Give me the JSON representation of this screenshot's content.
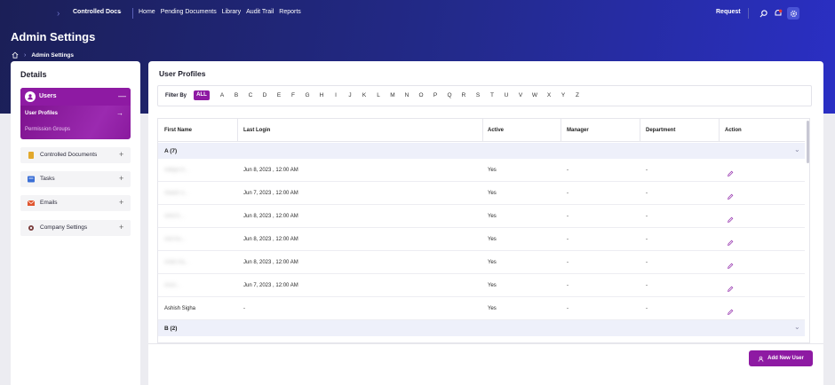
{
  "topbar": {
    "brand": "Controlled Docs",
    "nav": [
      "Home",
      "Pending Documents",
      "Library",
      "Audit Trail",
      "Reports"
    ],
    "request": "Request"
  },
  "header": {
    "title": "Admin Settings",
    "breadcrumb": "Admin Settings"
  },
  "sidebar": {
    "title": "Details",
    "users_label": "Users",
    "sub_items": [
      "User Profiles",
      "Permission Groups"
    ],
    "items": [
      {
        "label": "Controlled Documents",
        "icon": "document-icon",
        "color": "#e2a82c"
      },
      {
        "label": "Tasks",
        "icon": "tasks-icon",
        "color": "#3b6fd6"
      },
      {
        "label": "Emails",
        "icon": "mail-icon",
        "color": "#e0552f"
      },
      {
        "label": "Company Settings",
        "icon": "gear-icon",
        "color": "#7a3c3c"
      }
    ]
  },
  "main": {
    "title": "User Profiles",
    "filter_label": "Filter By",
    "filter_all": "ALL",
    "letters": [
      "A",
      "B",
      "C",
      "D",
      "E",
      "F",
      "G",
      "H",
      "I",
      "J",
      "K",
      "L",
      "M",
      "N",
      "O",
      "P",
      "Q",
      "R",
      "S",
      "T",
      "U",
      "V",
      "W",
      "X",
      "Y",
      "Z"
    ],
    "columns": [
      "First Name",
      "Last Login",
      "Active",
      "Manager",
      "Department",
      "Action"
    ],
    "groups": [
      {
        "label": "A (7)",
        "rows": [
          {
            "name": "Aditya R...",
            "last_login": "Jun 8, 2023 , 12:00 AM",
            "active": "Yes",
            "manager": "-",
            "department": "-"
          },
          {
            "name": "Akash S...",
            "last_login": "Jun 7, 2023 , 12:00 AM",
            "active": "Yes",
            "manager": "-",
            "department": "-"
          },
          {
            "name": "Amit K...",
            "last_login": "Jun 8, 2023 , 12:00 AM",
            "active": "Yes",
            "manager": "-",
            "department": "-"
          },
          {
            "name": "Anil Ku...",
            "last_login": "Jun 8, 2023 , 12:00 AM",
            "active": "Yes",
            "manager": "-",
            "department": "-"
          },
          {
            "name": "Ankit Ra...",
            "last_login": "Jun 8, 2023 , 12:00 AM",
            "active": "Yes",
            "manager": "-",
            "department": "-"
          },
          {
            "name": "Arun...",
            "last_login": "Jun 7, 2023 , 12:00 AM",
            "active": "Yes",
            "manager": "-",
            "department": "-"
          },
          {
            "name": "Ashish Sigha",
            "last_login": "-",
            "active": "Yes",
            "manager": "-",
            "department": "-"
          }
        ]
      },
      {
        "label": "B (2)",
        "rows": []
      }
    ],
    "add_button": "Add New User"
  },
  "colors": {
    "accent": "#8e1aa3",
    "header_start": "#1b1f57",
    "header_end": "#2a2fc4"
  }
}
